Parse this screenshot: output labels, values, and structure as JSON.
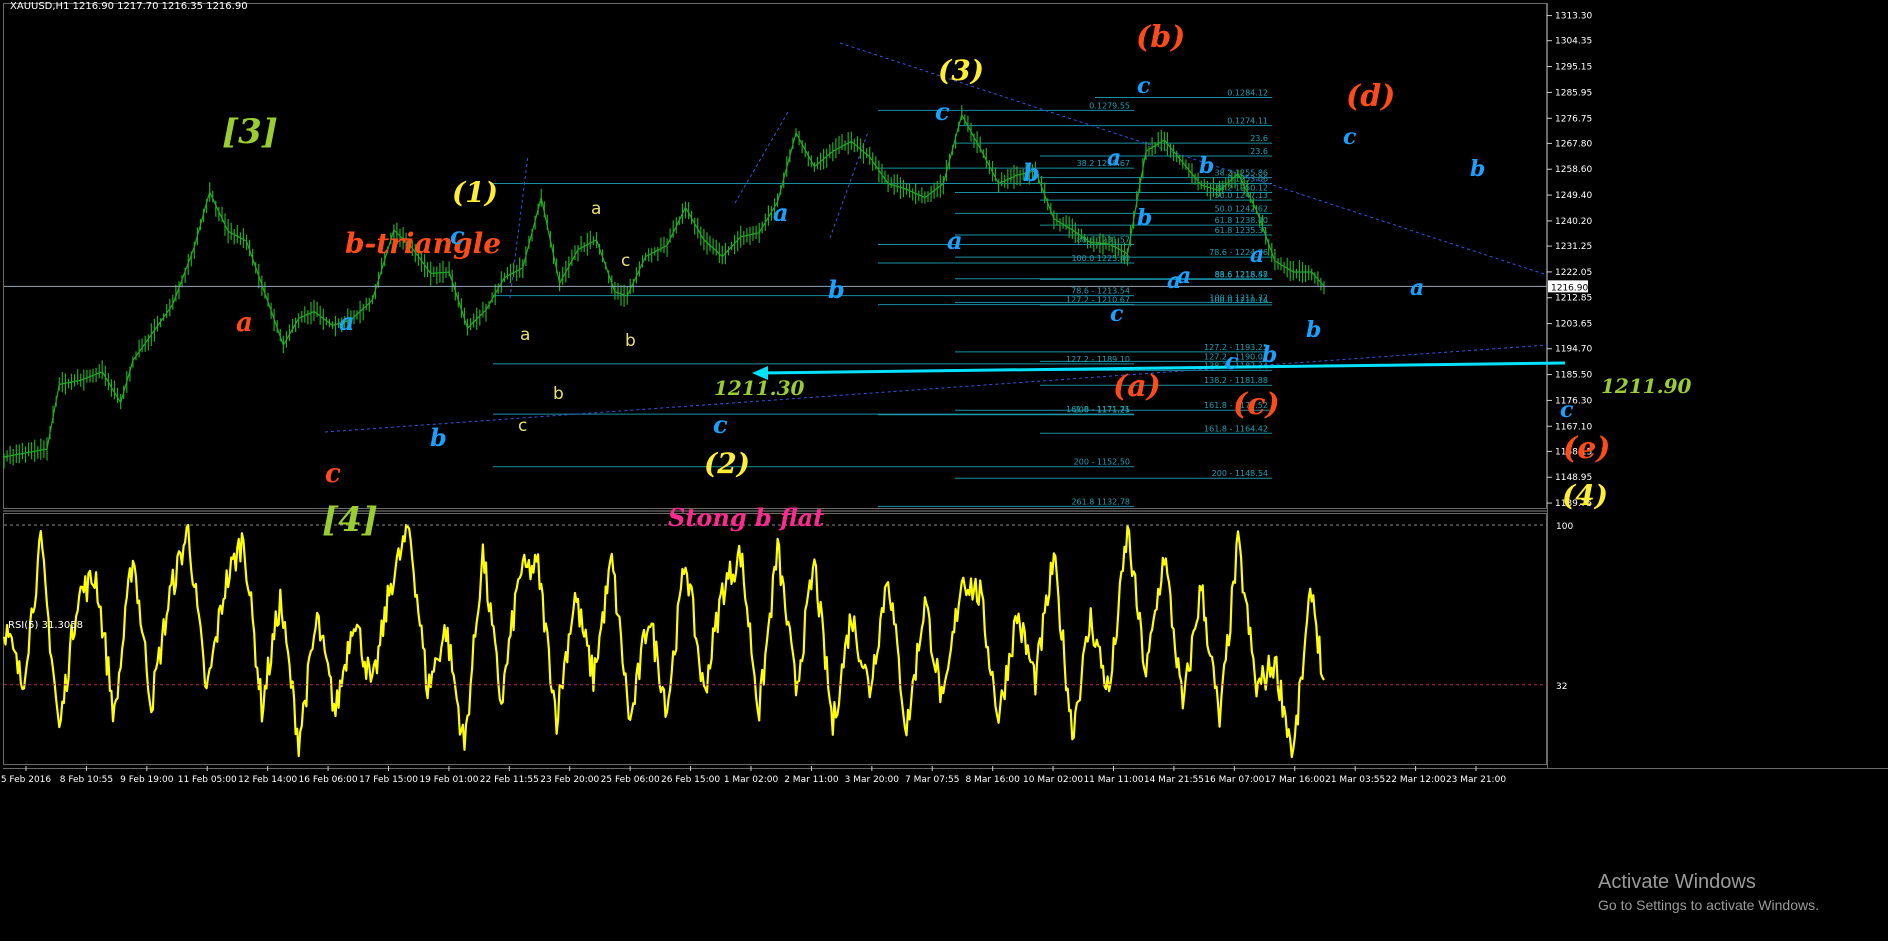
{
  "header": {
    "symbol": "XAUUSD,H1  1216.90 1217.70 1216.35 1216.90",
    "rsi": "RSI(5) 31.3058"
  },
  "watermark": {
    "title": "Activate Windows",
    "subtitle": "Go to Settings to activate Windows."
  },
  "colors": {
    "background": "#000000",
    "price_line": "#22aa22",
    "rsi_line": "#ffff00",
    "fib_lines": "#1e9fb4",
    "trend_lines": "#3355dd",
    "cyan_arrow": "#00e0ff",
    "wave_orange": "#ff4a1a",
    "wave_yellow": "#ffee33",
    "wave_green": "#9acd32",
    "wave_blue": "#1aa0ff",
    "wave_pink": "#ff2a8f",
    "axis_text": "#ffffff"
  },
  "chart_data": [
    {
      "type": "line",
      "instrument": "XAUUSD,H1",
      "xlabels": [
        "5 Feb 2016",
        "8 Feb 10:55",
        "9 Feb 19:00",
        "11 Feb 05:00",
        "12 Feb 14:00",
        "16 Feb 06:00",
        "17 Feb 15:00",
        "19 Feb 01:00",
        "22 Feb 11:55",
        "23 Feb 20:00",
        "25 Feb 06:00",
        "26 Feb 15:00",
        "1 Mar 02:00",
        "2 Mar 11:00",
        "3 Mar 20:00",
        "7 Mar 07:55",
        "8 Mar 16:00",
        "10 Mar 02:00",
        "11 Mar 11:00",
        "14 Mar 21:55",
        "16 Mar 07:00",
        "17 Mar 16:00",
        "21 Mar 03:55",
        "22 Mar 12:00",
        "23 Mar 21:00"
      ],
      "ylim": [
        1138.0,
        1316.0
      ],
      "yticks": [
        1139.75,
        1148.95,
        1158.15,
        1167.1,
        1176.3,
        1185.5,
        1194.7,
        1203.65,
        1212.85,
        1222.05,
        1231.25,
        1240.2,
        1249.4,
        1258.6,
        1267.8,
        1276.75,
        1285.95,
        1295.15,
        1304.35,
        1313.3
      ],
      "current_price": "1216.90",
      "key_points": [
        {
          "x": 0,
          "y": 1156.2
        },
        {
          "x": 14,
          "y": 1159.0
        },
        {
          "x": 18,
          "y": 1182.0
        },
        {
          "x": 25,
          "y": 1183.5
        },
        {
          "x": 32,
          "y": 1186.5
        },
        {
          "x": 38,
          "y": 1175.5
        },
        {
          "x": 42,
          "y": 1190.5
        },
        {
          "x": 55,
          "y": 1210.5
        },
        {
          "x": 62,
          "y": 1231.0
        },
        {
          "x": 67,
          "y": 1250.5
        },
        {
          "x": 73,
          "y": 1236.5
        },
        {
          "x": 79,
          "y": 1233.0
        },
        {
          "x": 84,
          "y": 1217.5
        },
        {
          "x": 91,
          "y": 1196.0
        },
        {
          "x": 96,
          "y": 1205.5
        },
        {
          "x": 101,
          "y": 1208.0
        },
        {
          "x": 107,
          "y": 1203.0
        },
        {
          "x": 113,
          "y": 1205.0
        },
        {
          "x": 120,
          "y": 1212.0
        },
        {
          "x": 127,
          "y": 1237.0
        },
        {
          "x": 133,
          "y": 1230.5
        },
        {
          "x": 139,
          "y": 1221.5
        },
        {
          "x": 145,
          "y": 1222.0
        },
        {
          "x": 151,
          "y": 1202.0
        },
        {
          "x": 157,
          "y": 1208.5
        },
        {
          "x": 163,
          "y": 1220.0
        },
        {
          "x": 169,
          "y": 1223.5
        },
        {
          "x": 175,
          "y": 1248.5
        },
        {
          "x": 181,
          "y": 1218.0
        },
        {
          "x": 187,
          "y": 1230.0
        },
        {
          "x": 193,
          "y": 1233.5
        },
        {
          "x": 199,
          "y": 1215.0
        },
        {
          "x": 203,
          "y": 1213.5
        },
        {
          "x": 209,
          "y": 1227.5
        },
        {
          "x": 216,
          "y": 1231.5
        },
        {
          "x": 222,
          "y": 1245.0
        },
        {
          "x": 228,
          "y": 1233.5
        },
        {
          "x": 234,
          "y": 1227.5
        },
        {
          "x": 240,
          "y": 1234.5
        },
        {
          "x": 246,
          "y": 1236.0
        },
        {
          "x": 252,
          "y": 1247.0
        },
        {
          "x": 258,
          "y": 1271.5
        },
        {
          "x": 264,
          "y": 1259.5
        },
        {
          "x": 270,
          "y": 1265.0
        },
        {
          "x": 276,
          "y": 1268.5
        },
        {
          "x": 282,
          "y": 1263.0
        },
        {
          "x": 288,
          "y": 1253.5
        },
        {
          "x": 294,
          "y": 1251.5
        },
        {
          "x": 300,
          "y": 1248.5
        },
        {
          "x": 306,
          "y": 1253.5
        },
        {
          "x": 312,
          "y": 1278.0
        },
        {
          "x": 318,
          "y": 1266.0
        },
        {
          "x": 324,
          "y": 1253.5
        },
        {
          "x": 330,
          "y": 1256.5
        },
        {
          "x": 336,
          "y": 1258.0
        },
        {
          "x": 342,
          "y": 1241.0
        },
        {
          "x": 348,
          "y": 1237.0
        },
        {
          "x": 354,
          "y": 1232.5
        },
        {
          "x": 360,
          "y": 1232.0
        },
        {
          "x": 366,
          "y": 1228.5
        },
        {
          "x": 372,
          "y": 1265.0
        },
        {
          "x": 378,
          "y": 1269.0
        },
        {
          "x": 384,
          "y": 1261.0
        },
        {
          "x": 390,
          "y": 1253.0
        },
        {
          "x": 396,
          "y": 1251.0
        },
        {
          "x": 402,
          "y": 1257.0
        },
        {
          "x": 408,
          "y": 1244.0
        },
        {
          "x": 414,
          "y": 1226.0
        },
        {
          "x": 420,
          "y": 1222.0
        },
        {
          "x": 426,
          "y": 1222.0
        },
        {
          "x": 430,
          "y": 1217.0
        }
      ],
      "fib_levels": [
        {
          "text": "0.1284.12"
        },
        {
          "text": "0.1279.55"
        },
        {
          "text": "0.1274.11"
        },
        {
          "text": "23.6"
        },
        {
          "text": "23.6"
        },
        {
          "text": "38.2 1258.67"
        },
        {
          "text": "38.2 1255.86"
        },
        {
          "text": "0.1253.06"
        },
        {
          "text": "38.2 1250.12"
        },
        {
          "text": "50.0 1247.13"
        },
        {
          "text": "50.0 1242.62"
        },
        {
          "text": "61.8 1238.40"
        },
        {
          "text": "61.8 1235.31"
        },
        {
          "text": "88.6 1231.57"
        },
        {
          "text": "78.6 - 1224.76"
        },
        {
          "text": "100.0 1225.40"
        },
        {
          "text": "88.6 1218.48"
        },
        {
          "text": "88.6 1218.57"
        },
        {
          "text": "78.6 - 1213.54"
        },
        {
          "text": "100.0 1211.32"
        },
        {
          "text": "127.2 - 1210.67"
        },
        {
          "text": "100.0 1210.14"
        },
        {
          "text": "127.2 - 1193.25"
        },
        {
          "text": "127.2 - 1189.10"
        },
        {
          "text": "127.2 - 1190.02"
        },
        {
          "text": "138.2 - 1187.34"
        },
        {
          "text": "138.2 - 1181.88"
        },
        {
          "text": "161.8 - 1171.71"
        },
        {
          "text": "161.8 - 1172.52"
        },
        {
          "text": "200 - 1171.25"
        },
        {
          "text": "161.8 - 1164.42"
        },
        {
          "text": "200 - 1152.50"
        },
        {
          "text": "200 - 1148.54"
        },
        {
          "text": "261.8 1132.78"
        }
      ],
      "annotations": [
        {
          "text": "[3]",
          "color": "green"
        },
        {
          "text": "[4]",
          "color": "green"
        },
        {
          "text": "b-triangle",
          "color": "orange"
        },
        {
          "text": "a",
          "color": "orange"
        },
        {
          "text": "c",
          "color": "orange"
        },
        {
          "text": "(1)",
          "color": "yellow"
        },
        {
          "text": "(2)",
          "color": "yellow"
        },
        {
          "text": "(3)",
          "color": "yellow"
        },
        {
          "text": "(4)",
          "color": "yellow"
        },
        {
          "text": "(b)",
          "color": "orange"
        },
        {
          "text": "(a)",
          "color": "orange"
        },
        {
          "text": "(c)",
          "color": "orange"
        },
        {
          "text": "(d)",
          "color": "orange"
        },
        {
          "text": "(e)",
          "color": "orange"
        },
        {
          "text": "1211.30",
          "color": "green"
        },
        {
          "text": "1211.90",
          "color": "green"
        },
        {
          "text": "Stong b flat",
          "color": "pink"
        },
        {
          "text": "a",
          "color": "blue"
        },
        {
          "text": "b",
          "color": "blue"
        },
        {
          "text": "c",
          "color": "blue"
        },
        {
          "text": "a",
          "color": "blue"
        },
        {
          "text": "b",
          "color": "blue"
        },
        {
          "text": "c",
          "color": "blue"
        },
        {
          "text": "a",
          "color": "blue"
        },
        {
          "text": "b",
          "color": "blue"
        },
        {
          "text": "c",
          "color": "blue"
        },
        {
          "text": "a",
          "color": "blue"
        },
        {
          "text": "b",
          "color": "blue"
        },
        {
          "text": "c",
          "color": "blue"
        },
        {
          "text": "a",
          "color": "blue"
        },
        {
          "text": "b",
          "color": "blue"
        },
        {
          "text": "c",
          "color": "blue"
        },
        {
          "text": "a",
          "color": "blue"
        },
        {
          "text": "b",
          "color": "blue"
        },
        {
          "text": "c",
          "color": "blue"
        },
        {
          "text": "a",
          "color": "blue"
        },
        {
          "text": "b",
          "color": "blue"
        },
        {
          "text": "c",
          "color": "blue"
        },
        {
          "text": "a",
          "color": "blue"
        },
        {
          "text": "b",
          "color": "blue"
        },
        {
          "text": "c",
          "color": "blue"
        },
        {
          "text": "a",
          "color": "small-yellow"
        },
        {
          "text": "b",
          "color": "small-yellow"
        },
        {
          "text": "c",
          "color": "small-yellow"
        },
        {
          "text": "a",
          "color": "small-yellow"
        },
        {
          "text": "b",
          "color": "small-yellow"
        },
        {
          "text": "c",
          "color": "small-yellow"
        }
      ]
    },
    {
      "type": "line",
      "indicator": "RSI(5) 31.3058",
      "ylim": [
        0,
        100
      ],
      "yticks": [
        "100",
        "32"
      ],
      "current_value": 31.3058,
      "key_points": [
        {
          "x": 0,
          "y": 58
        },
        {
          "x": 6,
          "y": 32
        },
        {
          "x": 12,
          "y": 92
        },
        {
          "x": 18,
          "y": 12
        },
        {
          "x": 24,
          "y": 70
        },
        {
          "x": 30,
          "y": 78
        },
        {
          "x": 36,
          "y": 18
        },
        {
          "x": 42,
          "y": 88
        },
        {
          "x": 48,
          "y": 24
        },
        {
          "x": 54,
          "y": 70
        },
        {
          "x": 60,
          "y": 98
        },
        {
          "x": 66,
          "y": 28
        },
        {
          "x": 72,
          "y": 74
        },
        {
          "x": 78,
          "y": 95
        },
        {
          "x": 84,
          "y": 22
        },
        {
          "x": 90,
          "y": 68
        },
        {
          "x": 96,
          "y": 8
        },
        {
          "x": 102,
          "y": 60
        },
        {
          "x": 108,
          "y": 20
        },
        {
          "x": 114,
          "y": 62
        },
        {
          "x": 120,
          "y": 30
        },
        {
          "x": 126,
          "y": 75
        },
        {
          "x": 132,
          "y": 99
        },
        {
          "x": 138,
          "y": 30
        },
        {
          "x": 144,
          "y": 56
        },
        {
          "x": 150,
          "y": 5
        },
        {
          "x": 156,
          "y": 88
        },
        {
          "x": 162,
          "y": 24
        },
        {
          "x": 168,
          "y": 80
        },
        {
          "x": 174,
          "y": 82
        },
        {
          "x": 180,
          "y": 18
        },
        {
          "x": 186,
          "y": 70
        },
        {
          "x": 192,
          "y": 35
        },
        {
          "x": 198,
          "y": 85
        },
        {
          "x": 204,
          "y": 15
        },
        {
          "x": 210,
          "y": 62
        },
        {
          "x": 216,
          "y": 22
        },
        {
          "x": 222,
          "y": 86
        },
        {
          "x": 228,
          "y": 28
        },
        {
          "x": 234,
          "y": 72
        },
        {
          "x": 240,
          "y": 88
        },
        {
          "x": 246,
          "y": 20
        },
        {
          "x": 252,
          "y": 90
        },
        {
          "x": 258,
          "y": 30
        },
        {
          "x": 264,
          "y": 84
        },
        {
          "x": 270,
          "y": 14
        },
        {
          "x": 276,
          "y": 62
        },
        {
          "x": 282,
          "y": 30
        },
        {
          "x": 288,
          "y": 80
        },
        {
          "x": 294,
          "y": 12
        },
        {
          "x": 300,
          "y": 68
        },
        {
          "x": 306,
          "y": 22
        },
        {
          "x": 312,
          "y": 78
        },
        {
          "x": 318,
          "y": 70
        },
        {
          "x": 324,
          "y": 18
        },
        {
          "x": 330,
          "y": 62
        },
        {
          "x": 336,
          "y": 34
        },
        {
          "x": 342,
          "y": 86
        },
        {
          "x": 348,
          "y": 12
        },
        {
          "x": 354,
          "y": 60
        },
        {
          "x": 360,
          "y": 28
        },
        {
          "x": 366,
          "y": 98
        },
        {
          "x": 372,
          "y": 36
        },
        {
          "x": 378,
          "y": 88
        },
        {
          "x": 384,
          "y": 22
        },
        {
          "x": 390,
          "y": 74
        },
        {
          "x": 396,
          "y": 16
        },
        {
          "x": 402,
          "y": 92
        },
        {
          "x": 408,
          "y": 30
        },
        {
          "x": 414,
          "y": 42
        },
        {
          "x": 420,
          "y": 2
        },
        {
          "x": 426,
          "y": 74
        },
        {
          "x": 430,
          "y": 31
        }
      ]
    }
  ]
}
